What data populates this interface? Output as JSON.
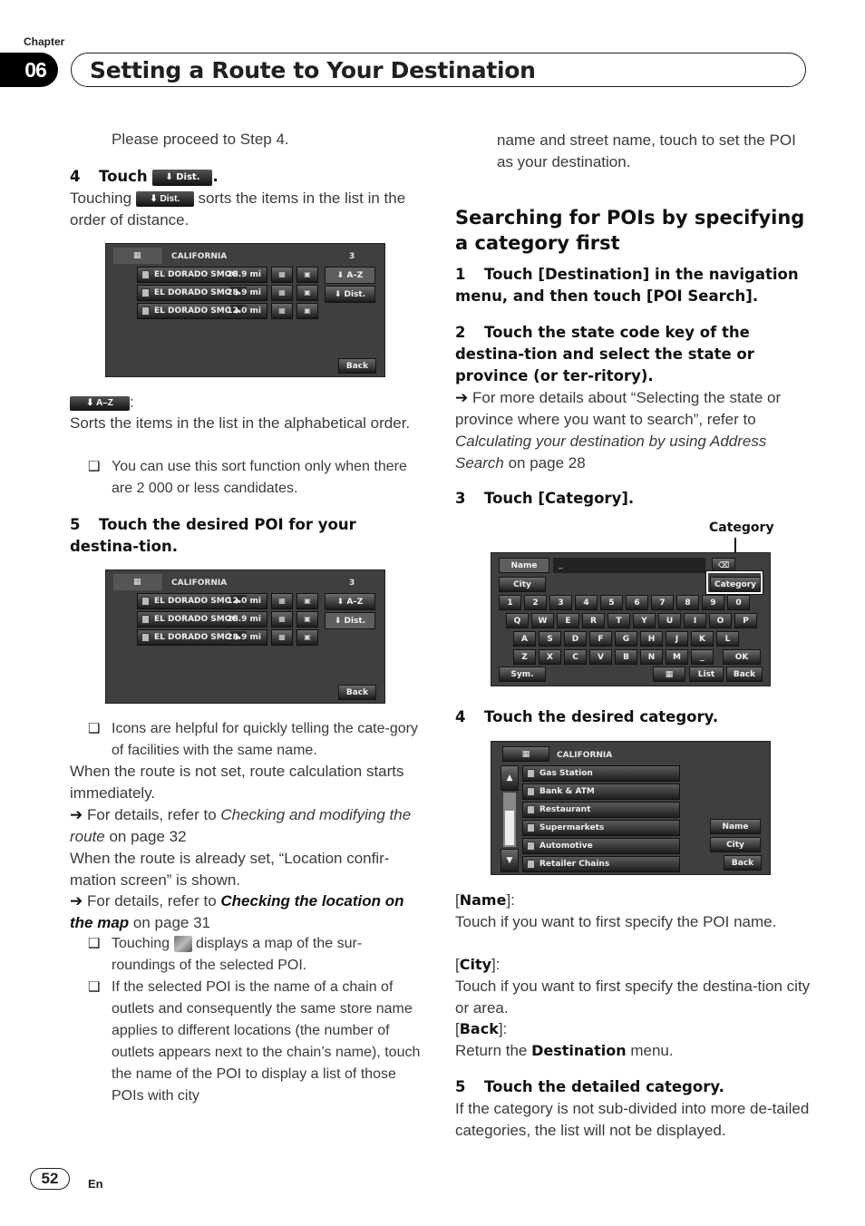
{
  "header": {
    "chapter_label": "Chapter",
    "chapter_number": "06",
    "chapter_title": "Setting a Route to Your Destination"
  },
  "left": {
    "proceed": "Please proceed to Step 4.",
    "step4": {
      "num": "4",
      "pre": "Touch",
      "btn": "Dist.",
      "post": "."
    },
    "step4_desc": {
      "pre": "Touching",
      "btn": "Dist.",
      "post": "sorts the items in the list in the order of distance."
    },
    "az_btn": "A–Z",
    "az_colon": ":",
    "az_desc": "Sorts the items in the list in the alphabetical order.",
    "az_note": "You can use this sort function only when there are 2 000 or less candidates.",
    "step5": {
      "num": "5",
      "text": "Touch the desired POI for your destina-tion."
    },
    "note_icons": "Icons are helpful for quickly telling the cate-gory of facilities with the same name.",
    "route_not_set": "When the route is not set, route calculation starts immediately.",
    "ref1": {
      "pre": "For details, refer to ",
      "italic": "Checking and modifying the route",
      "post": " on page 32"
    },
    "route_set": "When the route is already set, “Location confir-mation screen” is shown.",
    "ref2": {
      "pre": "For details, refer to ",
      "bold_italic": "Checking the location on the map",
      "post": " on page 31"
    },
    "note_map": {
      "pre": "Touching",
      "post": "displays a map of the sur-roundings of the selected POI."
    },
    "note_chain": "If the selected POI is the name of a chain of outlets and consequently the same store name applies to different locations (the number of outlets appears next to the chain’s name), touch the name of the POI to display a list of those POIs with city"
  },
  "right": {
    "cont": "name and street name, touch to set the POI as your destination.",
    "section_heading": "Searching for POIs by specifying a category first",
    "step1": {
      "num": "1",
      "text": "Touch [Destination] in the navigation menu, and then touch [POI Search]."
    },
    "step2": {
      "num": "2",
      "text": "Touch the state code key of the destina-tion and select the state or province (or ter-ritory)."
    },
    "ref3": {
      "pre": "For more details about “Selecting the state or province where you want to search”, refer to ",
      "italic": "Calculating your destination by using Address Search",
      "post": " on page 28"
    },
    "step3": {
      "num": "3",
      "text": "Touch [Category]."
    },
    "callout": "Category",
    "step4": {
      "num": "4",
      "text": "Touch the desired category."
    },
    "name_label": "Name",
    "name_desc": "Touch if you want to first specify the POI name.",
    "city_label": "City",
    "city_desc": "Touch if you want to first specify the destina-tion city or area.",
    "back_label": "Back",
    "back_desc": {
      "pre": "Return the ",
      "bold": "Destination",
      "post": " menu."
    },
    "step5": {
      "num": "5",
      "text": "Touch the detailed category."
    },
    "step5_desc": "If the category is not sub-divided into more de-tailed categories, the list will not be displayed."
  },
  "screen1": {
    "state": "CALIFORNIA",
    "count": "3",
    "rows": [
      {
        "name": "EL DORADO SMOG",
        "dist": "28.9 mi",
        "play": false
      },
      {
        "name": "EL DORADO SMOG",
        "dist": "28.9 mi",
        "play": true
      },
      {
        "name": "EL DORADO SMOG",
        "dist": "12.0 mi",
        "play": true
      }
    ],
    "btn_az": "A–Z",
    "btn_dist": "Dist.",
    "btn_back": "Back"
  },
  "screen2": {
    "state": "CALIFORNIA",
    "count": "3",
    "rows": [
      {
        "name": "EL DORADO SMOG",
        "dist": "12.0 mi",
        "play": true
      },
      {
        "name": "EL DORADO SMOG",
        "dist": "28.9 mi",
        "play": false
      },
      {
        "name": "EL DORADO SMOG",
        "dist": "28.9 mi",
        "play": true
      }
    ],
    "btn_az": "A–Z",
    "btn_dist": "Dist.",
    "btn_back": "Back"
  },
  "keyboard": {
    "name_btn": "Name",
    "input_value": "_",
    "city_btn": "City",
    "category_btn": "Category",
    "row1": [
      "1",
      "2",
      "3",
      "4",
      "5",
      "6",
      "7",
      "8",
      "9",
      "0"
    ],
    "row2": [
      "Q",
      "W",
      "E",
      "R",
      "T",
      "Y",
      "U",
      "I",
      "O",
      "P"
    ],
    "row3": [
      "A",
      "S",
      "D",
      "F",
      "G",
      "H",
      "J",
      "K",
      "L"
    ],
    "row4": [
      "Z",
      "X",
      "C",
      "V",
      "B",
      "N",
      "M",
      "_"
    ],
    "ok": "OK",
    "sym": "Sym.",
    "list": "List",
    "back": "Back"
  },
  "category_screen": {
    "state": "CALIFORNIA",
    "items": [
      "Gas Station",
      "Bank & ATM",
      "Restaurant",
      "Supermarkets",
      "Automotive",
      "Retailer Chains"
    ],
    "btn_name": "Name",
    "btn_city": "City",
    "btn_back": "Back"
  },
  "footer": {
    "page": "52",
    "lang": "En"
  }
}
